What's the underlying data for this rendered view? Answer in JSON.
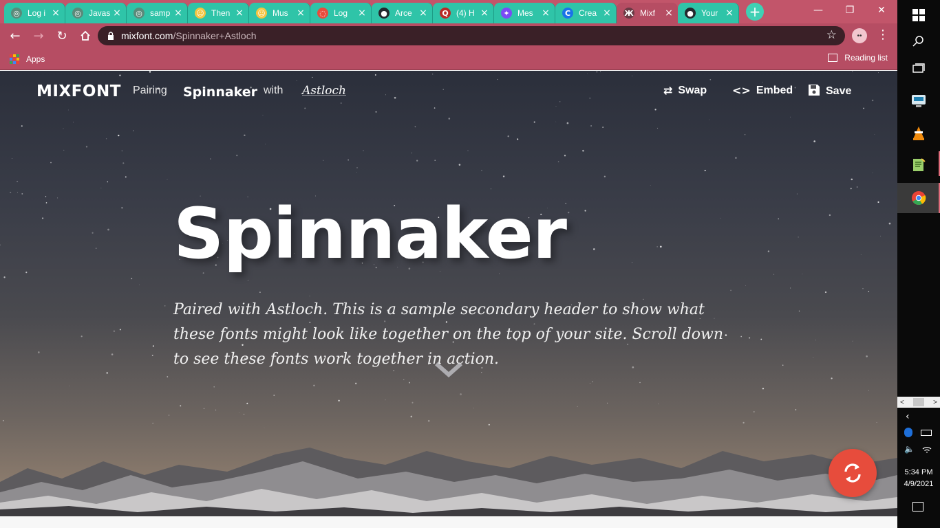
{
  "browser": {
    "tabs": [
      {
        "title": "Log i",
        "fav_color": "#5a8a7a",
        "fav_glyph": "◎"
      },
      {
        "title": "Javas",
        "fav_color": "#5a8a7a",
        "fav_glyph": "◎"
      },
      {
        "title": "samp",
        "fav_color": "#5a8a7a",
        "fav_glyph": "◎"
      },
      {
        "title": "Then",
        "fav_color": "#f4c542",
        "fav_glyph": "☺"
      },
      {
        "title": "Mus",
        "fav_color": "#f4c542",
        "fav_glyph": "☺"
      },
      {
        "title": "Log",
        "fav_color": "#e74c3c",
        "fav_glyph": "◌"
      },
      {
        "title": "Arce",
        "fav_color": "#24292e",
        "fav_glyph": "●"
      },
      {
        "title": "(4) H",
        "fav_color": "#b92b27",
        "fav_glyph": "Q"
      },
      {
        "title": "Mes",
        "fav_color": "#7b4bf5",
        "fav_glyph": "✦"
      },
      {
        "title": "Crea",
        "fav_color": "#1a73e8",
        "fav_glyph": "C"
      },
      {
        "title": "Mixf",
        "fav_color": "#6b3a45",
        "fav_glyph": "Ж",
        "active": true
      },
      {
        "title": "Your",
        "fav_color": "#24292e",
        "fav_glyph": "●"
      }
    ],
    "new_tab": "+",
    "window_controls": {
      "minimize": "—",
      "restore": "❐",
      "close": "✕"
    },
    "url_host": "mixfont.com",
    "url_path": "/Spinnaker+Astloch",
    "bookmark_apps": "Apps",
    "reading_list": "Reading list"
  },
  "site": {
    "logo": "MIXFONT",
    "pairing_label": "Pairing",
    "font_primary": "Spinnaker",
    "with_label": "with",
    "font_secondary": "Astloch",
    "actions": {
      "swap": "Swap",
      "embed": "Embed",
      "save": "Save"
    },
    "hero_title": "Spinnaker",
    "hero_subtitle": "Paired with Astloch. This is a sample secondary header to show what these fonts might look like together on the top of your site. Scroll down to see these fonts work together in action.",
    "accent": "#e74c3c"
  },
  "taskbar": {
    "time": "5:34 PM",
    "date": "4/9/2021",
    "icons": [
      "windows-icon",
      "search-icon",
      "task-view-icon",
      "app-icon",
      "vlc-icon",
      "notepad-icon",
      "chrome-icon"
    ]
  }
}
